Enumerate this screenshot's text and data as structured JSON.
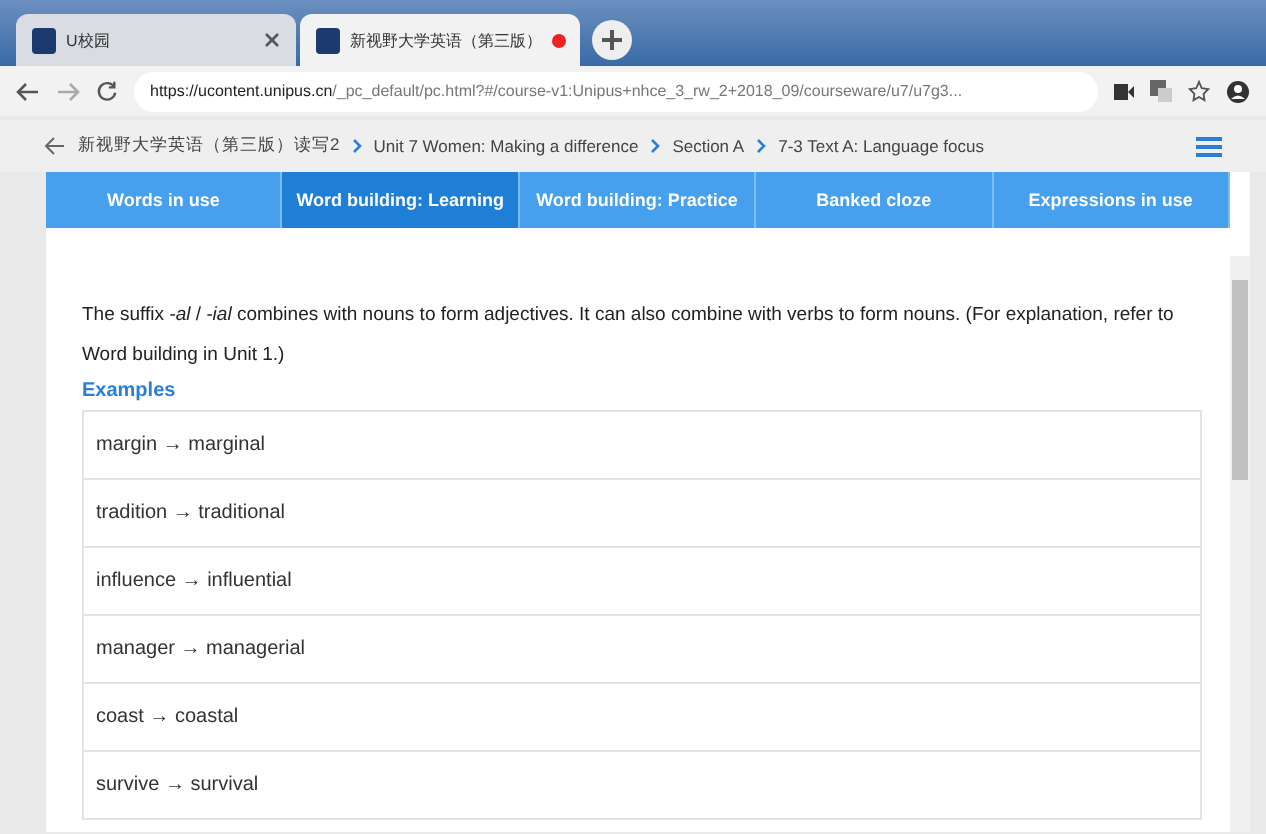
{
  "browser_tabs": [
    {
      "title": "U校园",
      "selected": false
    },
    {
      "title": "新视野大学英语（第三版）",
      "selected": true
    }
  ],
  "address_bar": {
    "url_host": "https://ucontent.unipus.cn",
    "url_path": "/_pc_default/pc.html?#/course-v1:Unipus+nhce_3_rw_2+2018_09/courseware/u7/u7g3..."
  },
  "breadcrumb": [
    "新视野大学英语（第三版）读写2",
    "Unit 7 Women: Making a difference",
    "Section A",
    "7-3 Text A: Language focus"
  ],
  "tabs": [
    {
      "label": "Words in use",
      "selected": false
    },
    {
      "label": "Word building: Learning",
      "selected": true
    },
    {
      "label": "Word building: Practice",
      "selected": false
    },
    {
      "label": "Banked cloze",
      "selected": false
    },
    {
      "label": "Expressions in use",
      "selected": false
    }
  ],
  "intro": "The suffix *-al* / *-ial* combines with nouns to form adjectives. It can also combine with verbs to form nouns. (For explanation, refer to Word building in Unit 1.)",
  "examples_heading": "Examples",
  "examples": [
    "margin → marginal",
    "tradition → traditional",
    "influence → influential",
    "manager → managerial",
    "coast → coastal",
    "survive → survival"
  ]
}
